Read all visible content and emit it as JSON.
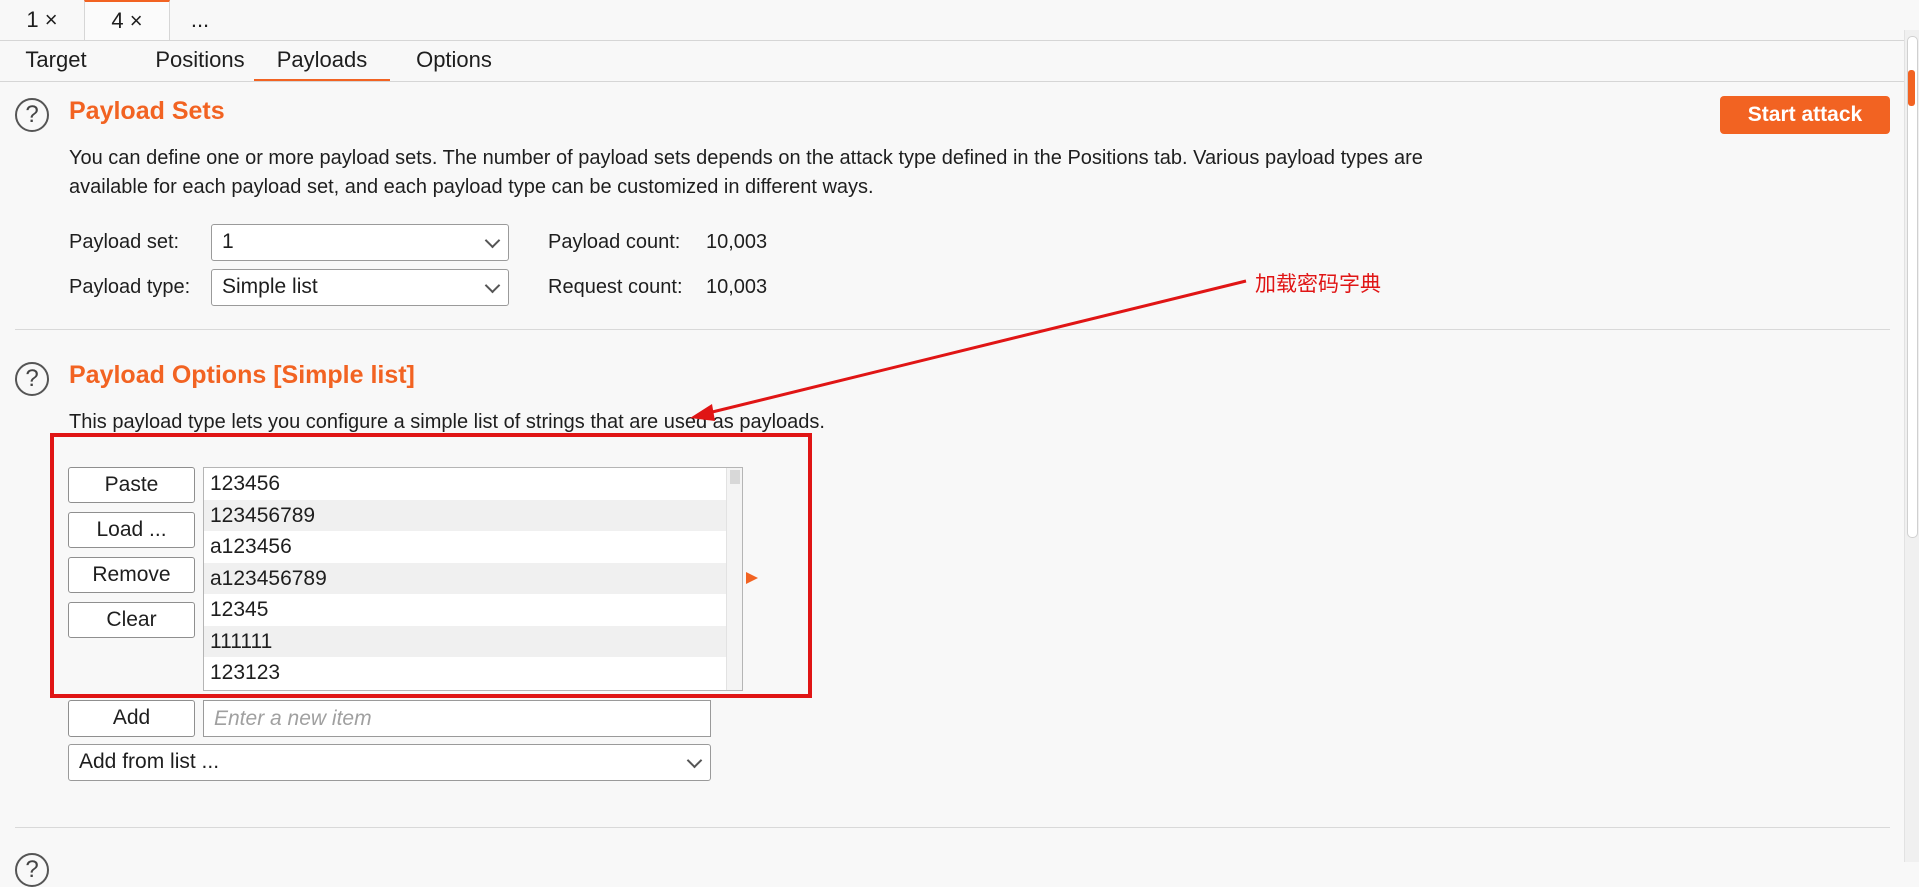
{
  "instance_tabs": [
    {
      "label": "1 ×"
    },
    {
      "label": "4 ×"
    },
    {
      "label": "..."
    }
  ],
  "sub_tabs": [
    "Target",
    "Positions",
    "Payloads",
    "Options"
  ],
  "active_sub_tab": "Payloads",
  "payload_sets": {
    "title": "Payload Sets",
    "start_attack_label": "Start attack",
    "description_line1": "You can define one or more payload sets. The number of payload sets depends on the attack type defined in the Positions tab. Various payload types are",
    "description_line2": "available for each payload set, and each payload type can be customized in different ways.",
    "set_label": "Payload set:",
    "set_value": "1",
    "type_label": "Payload type:",
    "type_value": "Simple list",
    "payload_count_label": "Payload count:",
    "payload_count_value": "10,003",
    "request_count_label": "Request count:",
    "request_count_value": "10,003"
  },
  "payload_options": {
    "title": "Payload Options [Simple list]",
    "description": "This payload type lets you configure a simple list of strings that are used as payloads.",
    "buttons": {
      "paste": "Paste",
      "load": "Load ...",
      "remove": "Remove",
      "clear": "Clear",
      "add": "Add"
    },
    "list_items": [
      "123456",
      "123456789",
      "a123456",
      "a123456789",
      "12345",
      "111111",
      "123123"
    ],
    "new_item_placeholder": "Enter a new item",
    "add_from_list": "Add from list ..."
  },
  "annotation": {
    "text": "加载密码字典",
    "color": "#e01515"
  },
  "colors": {
    "accent": "#f26322"
  }
}
